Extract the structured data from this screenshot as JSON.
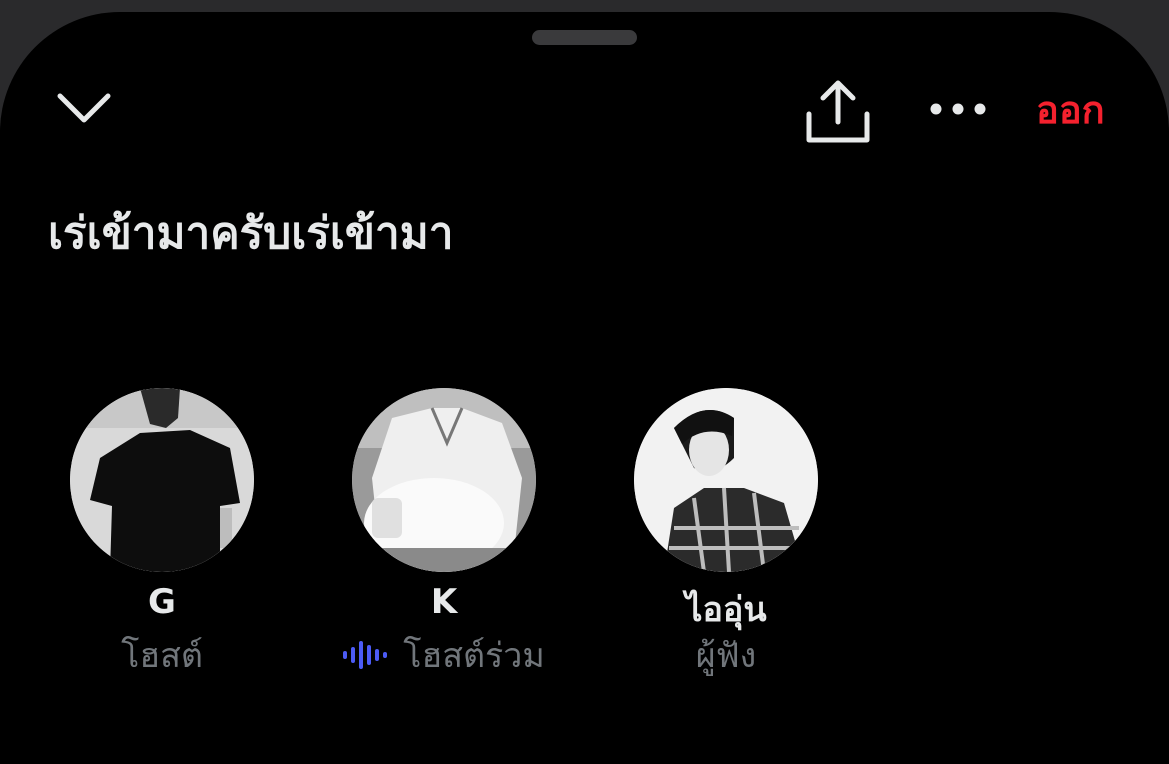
{
  "header": {
    "leave_label": "ออก",
    "leave_color": "#f4212e",
    "collapse_icon": "chevron-down-icon",
    "share_icon": "share-icon",
    "more_icon": "more-horizontal-icon"
  },
  "space": {
    "title": "เร่เข้ามาครับเร่เข้ามา"
  },
  "participants": [
    {
      "name": "G",
      "role": "โฮสต์",
      "speaking": false
    },
    {
      "name": "K",
      "role": "โฮสต์ร่วม",
      "speaking": true,
      "speaking_icon": "audio-wave-icon",
      "speaking_color": "#4c5bf5"
    },
    {
      "name": "ไออุ่น",
      "role": "ผู้ฟัง",
      "speaking": false
    }
  ]
}
